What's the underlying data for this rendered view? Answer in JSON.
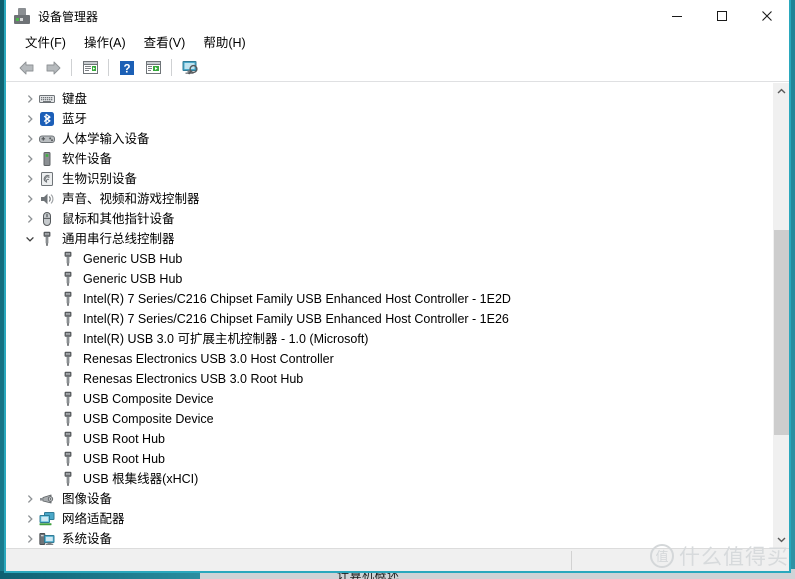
{
  "window": {
    "title": "设备管理器",
    "app_icon": "device-manager-icon",
    "controls": {
      "minimize": "minimize-icon",
      "maximize": "maximize-icon",
      "close": "close-icon"
    },
    "border_color": "#2aa8bd"
  },
  "menubar": {
    "items": [
      {
        "label": "文件(F)"
      },
      {
        "label": "操作(A)"
      },
      {
        "label": "查看(V)"
      },
      {
        "label": "帮助(H)"
      }
    ]
  },
  "toolbar": {
    "buttons": [
      {
        "name": "back-button",
        "icon": "back-arrow-icon"
      },
      {
        "name": "forward-button",
        "icon": "forward-arrow-icon"
      },
      {
        "name": "properties-button",
        "icon": "properties-window-icon"
      },
      {
        "name": "help-button",
        "icon": "help-question-icon"
      },
      {
        "name": "scan-hardware-button",
        "icon": "scan-window-icon"
      },
      {
        "name": "update-driver-button",
        "icon": "monitor-search-icon"
      }
    ]
  },
  "tree": {
    "items": [
      {
        "label": "键盘",
        "icon": "keyboard-icon",
        "level": 1,
        "expanded": false,
        "expandable": true
      },
      {
        "label": "蓝牙",
        "icon": "bluetooth-icon",
        "level": 1,
        "expanded": false,
        "expandable": true
      },
      {
        "label": "人体学输入设备",
        "icon": "hid-gamepad-icon",
        "level": 1,
        "expanded": false,
        "expandable": true
      },
      {
        "label": "软件设备",
        "icon": "software-device-icon",
        "level": 1,
        "expanded": false,
        "expandable": true
      },
      {
        "label": "生物识别设备",
        "icon": "fingerprint-icon",
        "level": 1,
        "expanded": false,
        "expandable": true
      },
      {
        "label": "声音、视频和游戏控制器",
        "icon": "speaker-icon",
        "level": 1,
        "expanded": false,
        "expandable": true
      },
      {
        "label": "鼠标和其他指针设备",
        "icon": "mouse-icon",
        "level": 1,
        "expanded": false,
        "expandable": true
      },
      {
        "label": "通用串行总线控制器",
        "icon": "usb-icon",
        "level": 1,
        "expanded": true,
        "expandable": true
      },
      {
        "label": "Generic USB Hub",
        "icon": "usb-icon",
        "level": 2,
        "expandable": false
      },
      {
        "label": "Generic USB Hub",
        "icon": "usb-icon",
        "level": 2,
        "expandable": false
      },
      {
        "label": "Intel(R) 7 Series/C216 Chipset Family USB Enhanced Host Controller - 1E2D",
        "icon": "usb-icon",
        "level": 2,
        "expandable": false
      },
      {
        "label": "Intel(R) 7 Series/C216 Chipset Family USB Enhanced Host Controller - 1E26",
        "icon": "usb-icon",
        "level": 2,
        "expandable": false
      },
      {
        "label": "Intel(R) USB 3.0 可扩展主机控制器 - 1.0 (Microsoft)",
        "icon": "usb-icon",
        "level": 2,
        "expandable": false
      },
      {
        "label": "Renesas Electronics USB 3.0 Host Controller",
        "icon": "usb-icon",
        "level": 2,
        "expandable": false
      },
      {
        "label": "Renesas Electronics USB 3.0 Root Hub",
        "icon": "usb-icon",
        "level": 2,
        "expandable": false
      },
      {
        "label": "USB Composite Device",
        "icon": "usb-icon",
        "level": 2,
        "expandable": false
      },
      {
        "label": "USB Composite Device",
        "icon": "usb-icon",
        "level": 2,
        "expandable": false
      },
      {
        "label": "USB Root Hub",
        "icon": "usb-icon",
        "level": 2,
        "expandable": false
      },
      {
        "label": "USB Root Hub",
        "icon": "usb-icon",
        "level": 2,
        "expandable": false
      },
      {
        "label": "USB 根集线器(xHCI)",
        "icon": "usb-icon",
        "level": 2,
        "expandable": false
      },
      {
        "label": "图像设备",
        "icon": "imaging-camera-icon",
        "level": 1,
        "expanded": false,
        "expandable": true
      },
      {
        "label": "网络适配器",
        "icon": "network-adapter-icon",
        "level": 1,
        "expanded": false,
        "expandable": true
      },
      {
        "label": "系统设备",
        "icon": "system-device-icon",
        "level": 1,
        "expanded": false,
        "expandable": true
      }
    ]
  },
  "scrollbar": {
    "up_icon": "chevron-up-icon",
    "down_icon": "chevron-down-icon"
  },
  "statusbar": {
    "text": ""
  },
  "watermark": {
    "logo_char": "值",
    "text": "什么值得买"
  },
  "background": {
    "caption": "计算机概述"
  }
}
